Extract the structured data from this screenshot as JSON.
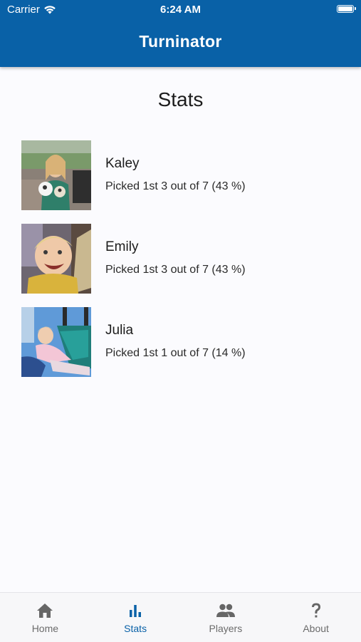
{
  "status_bar": {
    "carrier": "Carrier",
    "time": "6:24 AM"
  },
  "app_bar": {
    "title": "Turninator",
    "background_color": "#0961a7"
  },
  "page": {
    "heading": "Stats"
  },
  "players": [
    {
      "name": "Kaley",
      "stat": "Picked 1st 3 out of 7 (43 %)"
    },
    {
      "name": "Emily",
      "stat": "Picked 1st 3 out of 7 (43 %)"
    },
    {
      "name": "Julia",
      "stat": "Picked 1st 1 out of 7 (14 %)"
    }
  ],
  "tab_bar": {
    "active_color": "#0961a7",
    "tabs": [
      {
        "label": "Home",
        "icon": "home-icon",
        "active": false
      },
      {
        "label": "Stats",
        "icon": "bar-chart-icon",
        "active": true
      },
      {
        "label": "Players",
        "icon": "people-icon",
        "active": false
      },
      {
        "label": "About",
        "icon": "question-mark-icon",
        "active": false
      }
    ]
  }
}
